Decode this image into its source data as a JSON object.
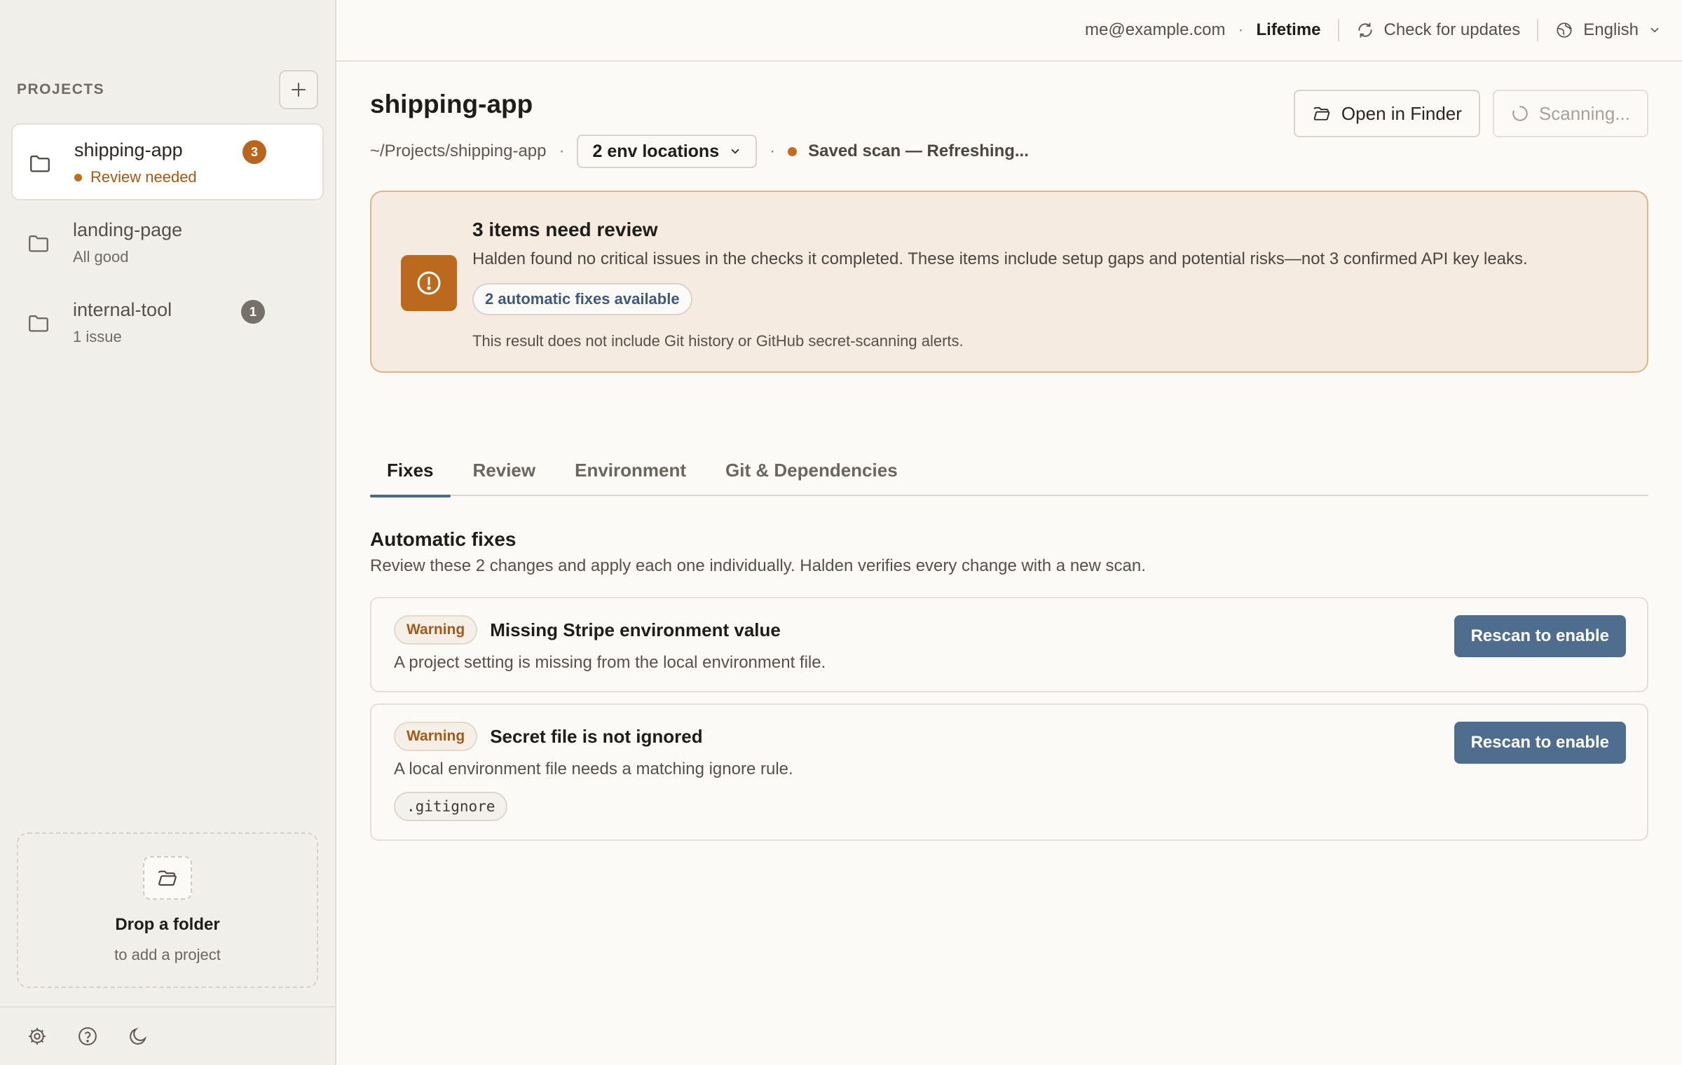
{
  "sidebar": {
    "projects_label": "PROJECTS",
    "projects": [
      {
        "name": "shipping-app",
        "status": "Review needed",
        "count": "3",
        "active": true
      },
      {
        "name": "landing-page",
        "status": "All good",
        "count": "",
        "active": false
      },
      {
        "name": "internal-tool",
        "status": "1 issue",
        "count": "1",
        "active": false
      }
    ],
    "dropzone": {
      "title": "Drop a folder",
      "subtitle": "to add a project"
    }
  },
  "topbar": {
    "email": "me@example.com",
    "separator": "·",
    "plan": "Lifetime",
    "check_updates": "Check for updates",
    "language": "English"
  },
  "header": {
    "title": "shipping-app",
    "path": "~/Projects/shipping-app",
    "env_locations": "2 env locations",
    "scan_status": "Saved scan — Refreshing...",
    "open_finder": "Open in Finder",
    "scanning": "Scanning..."
  },
  "alert": {
    "title": "3 items need review",
    "description": "Halden found no critical issues in the checks it completed. These items include setup gaps and potential risks—not 3 confirmed API key leaks.",
    "fixes_pill": "2 automatic fixes available",
    "note": "This result does not include Git history or GitHub secret-scanning alerts."
  },
  "tabs": [
    {
      "label": "Fixes",
      "active": true
    },
    {
      "label": "Review",
      "active": false
    },
    {
      "label": "Environment",
      "active": false
    },
    {
      "label": "Git & Dependencies",
      "active": false
    }
  ],
  "fixes": {
    "title": "Automatic fixes",
    "description": "Review these 2 changes and apply each one individually. Halden verifies every change with a new scan.",
    "items": [
      {
        "severity": "Warning",
        "title": "Missing Stripe environment value",
        "description": "A project setting is missing from the local environment file.",
        "action": "Rescan to enable"
      },
      {
        "severity": "Warning",
        "title": "Secret file is not ignored",
        "description": "A local environment file needs a matching ignore rule.",
        "file": ".gitignore",
        "action": "Rescan to enable"
      }
    ]
  },
  "icons": {
    "add": "plus-icon",
    "folder": "folder-icon",
    "open_folder": "folder-open-icon",
    "refresh": "refresh-icon",
    "globe": "globe-icon",
    "chevron": "chevron-down-icon",
    "alert": "alert-circle-icon",
    "spinner": "spinner-icon",
    "settings": "gear-icon",
    "help": "help-icon",
    "theme": "moon-icon"
  },
  "colors": {
    "accent": "#4f6d8f",
    "warning": "#b7661c",
    "alert_bg": "#f5ebe0"
  }
}
